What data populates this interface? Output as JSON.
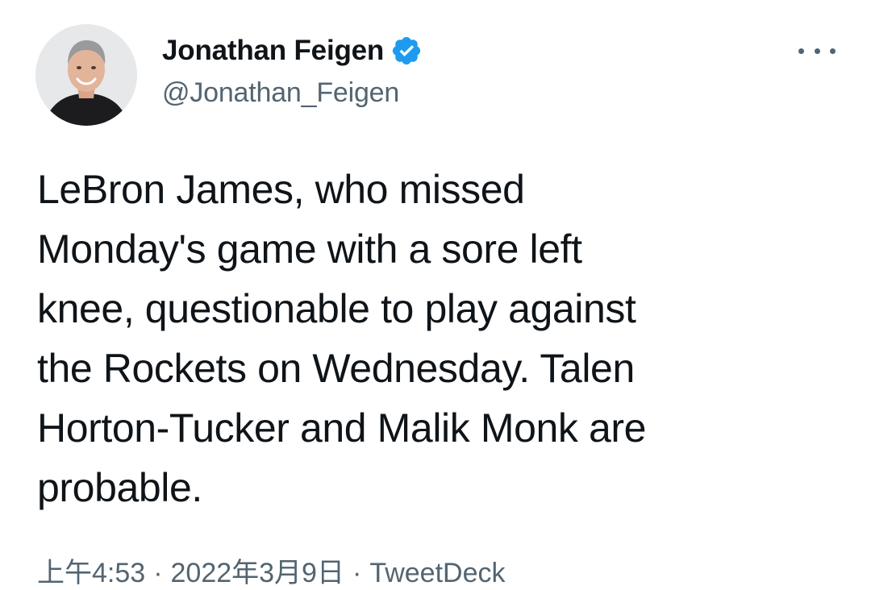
{
  "author": {
    "display_name": "Jonathan Feigen",
    "handle": "@Jonathan_Feigen",
    "verified": true,
    "avatar_icon": "user-avatar-photo",
    "verified_icon": "verified-badge-icon",
    "verified_color": "#1d9bf0"
  },
  "more_icon": "more-options-icon",
  "tweet": {
    "text": "LeBron James, who missed\nMonday's game with a sore left\nknee, questionable to play against\nthe Rockets on Wednesday. Talen\nHorton-Tucker and Malik Monk are\nprobable."
  },
  "meta": {
    "time": "上午4:53",
    "separator1": "·",
    "date": "2022年3月9日",
    "separator2": "·",
    "source": "TweetDeck"
  },
  "colors": {
    "text_primary": "#0f1419",
    "text_secondary": "#536471",
    "accent": "#1d9bf0",
    "background": "#ffffff"
  }
}
